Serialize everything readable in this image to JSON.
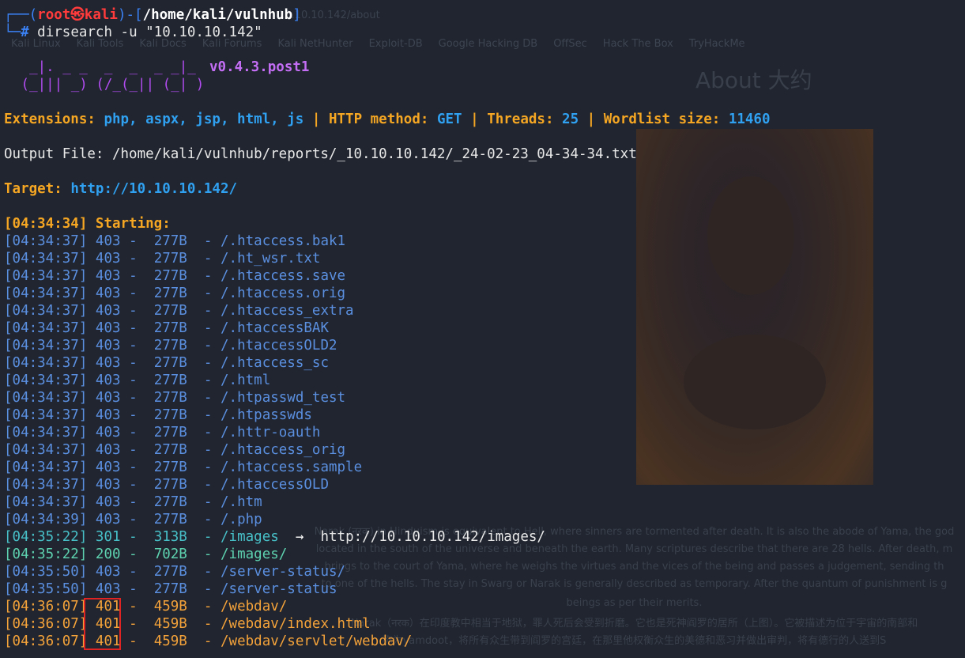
{
  "background": {
    "url": "10.10.10.142/about",
    "bookmarks": [
      "Kali Linux",
      "Kali Tools",
      "Kali Docs",
      "Kali Forums",
      "Kali NetHunter",
      "Exploit-DB",
      "Google Hacking DB",
      "OffSec",
      "Hack The Box",
      "TryHackMe"
    ],
    "about_title": "About 大约",
    "paragraph_lines": [
      "Narak (नरक) in Hinduism is equivalent to Hell, where sinners are tormented after death. It is also the abode of Yama, the god",
      "located in the south of the universe and beneath the earth. Many scriptures describe that there are 28 hells. After death, m",
      "brings to the court of Yama, where he weighs the virtues and the vices of the being and passes a judgement, sending th",
      "to one of the hells. The stay in Swarg or Narak is generally described as temporary. After the quantum of punishment is g",
      "beings as per their merits.",
      "Narak（नरक）在印度教中相当于地狱，罪人死后会受到折磨。它也是死神阎罗的居所（上图）。它被描述为位于宇宙的南部和",
      "称为yamdoot，将所有众生带到阎罗的宫廷，在那里他权衡众生的美德和恶习并做出审判，将有德行的人送到S"
    ]
  },
  "prompt": {
    "frame_top": "┌──(",
    "user": "root㉿kali",
    "frame_mid": ")-[",
    "path": "/home/kali/vulnhub",
    "frame_end": "]",
    "frame_bottom": "└─",
    "hash": "#",
    "command": "dirsearch",
    "args": "-u",
    "target_arg": "\"10.10.10.142\""
  },
  "banner": {
    "art": "  _|. _ _  _  _  _ _|_\n (_||| _) (/_(_|| (_| )",
    "version": "v0.4.3.post1"
  },
  "config": {
    "extensions_label": "Extensions:",
    "extensions": "php, aspx, jsp, html, js",
    "sep": "|",
    "method_label": "HTTP method:",
    "method": "GET",
    "threads_label": "Threads:",
    "threads": "25",
    "wordlist_label": "Wordlist size:",
    "wordlist": "11460"
  },
  "output_file": "Output File: /home/kali/vulnhub/reports/_10.10.10.142/_24-02-23_04-34-34.txt",
  "target": {
    "label": "Target:",
    "url": "http://10.10.10.142/"
  },
  "starting": {
    "time": "[04:34:34]",
    "label": "Starting:"
  },
  "results": [
    {
      "time": "[04:34:37]",
      "code": "403",
      "size": "277B",
      "path": "/.htaccess.bak1",
      "cls": "c403"
    },
    {
      "time": "[04:34:37]",
      "code": "403",
      "size": "277B",
      "path": "/.ht_wsr.txt",
      "cls": "c403"
    },
    {
      "time": "[04:34:37]",
      "code": "403",
      "size": "277B",
      "path": "/.htaccess.save",
      "cls": "c403"
    },
    {
      "time": "[04:34:37]",
      "code": "403",
      "size": "277B",
      "path": "/.htaccess.orig",
      "cls": "c403"
    },
    {
      "time": "[04:34:37]",
      "code": "403",
      "size": "277B",
      "path": "/.htaccess_extra",
      "cls": "c403"
    },
    {
      "time": "[04:34:37]",
      "code": "403",
      "size": "277B",
      "path": "/.htaccessBAK",
      "cls": "c403"
    },
    {
      "time": "[04:34:37]",
      "code": "403",
      "size": "277B",
      "path": "/.htaccessOLD2",
      "cls": "c403"
    },
    {
      "time": "[04:34:37]",
      "code": "403",
      "size": "277B",
      "path": "/.htaccess_sc",
      "cls": "c403"
    },
    {
      "time": "[04:34:37]",
      "code": "403",
      "size": "277B",
      "path": "/.html",
      "cls": "c403"
    },
    {
      "time": "[04:34:37]",
      "code": "403",
      "size": "277B",
      "path": "/.htpasswd_test",
      "cls": "c403"
    },
    {
      "time": "[04:34:37]",
      "code": "403",
      "size": "277B",
      "path": "/.htpasswds",
      "cls": "c403"
    },
    {
      "time": "[04:34:37]",
      "code": "403",
      "size": "277B",
      "path": "/.httr-oauth",
      "cls": "c403"
    },
    {
      "time": "[04:34:37]",
      "code": "403",
      "size": "277B",
      "path": "/.htaccess_orig",
      "cls": "c403"
    },
    {
      "time": "[04:34:37]",
      "code": "403",
      "size": "277B",
      "path": "/.htaccess.sample",
      "cls": "c403"
    },
    {
      "time": "[04:34:37]",
      "code": "403",
      "size": "277B",
      "path": "/.htaccessOLD",
      "cls": "c403"
    },
    {
      "time": "[04:34:37]",
      "code": "403",
      "size": "277B",
      "path": "/.htm",
      "cls": "c403"
    },
    {
      "time": "[04:34:39]",
      "code": "403",
      "size": "277B",
      "path": "/.php",
      "cls": "c403"
    },
    {
      "time": "[04:35:22]",
      "code": "301",
      "size": "313B",
      "path": "/images",
      "cls": "c301",
      "redirect": "http://10.10.10.142/images/"
    },
    {
      "time": "[04:35:22]",
      "code": "200",
      "size": "702B",
      "path": "/images/",
      "cls": "c200"
    },
    {
      "time": "[04:35:50]",
      "code": "403",
      "size": "277B",
      "path": "/server-status/",
      "cls": "c403"
    },
    {
      "time": "[04:35:50]",
      "code": "403",
      "size": "277B",
      "path": "/server-status",
      "cls": "c403"
    },
    {
      "time": "[04:36:07]",
      "code": "401",
      "size": "459B",
      "path": "/webdav/",
      "cls": "c401"
    },
    {
      "time": "[04:36:07]",
      "code": "401",
      "size": "459B",
      "path": "/webdav/index.html",
      "cls": "c401"
    },
    {
      "time": "[04:36:07]",
      "code": "401",
      "size": "459B",
      "path": "/webdav/servlet/webdav/",
      "cls": "c401"
    }
  ],
  "arrow": "→",
  "dash": "-",
  "highlight_color": "#e02424"
}
